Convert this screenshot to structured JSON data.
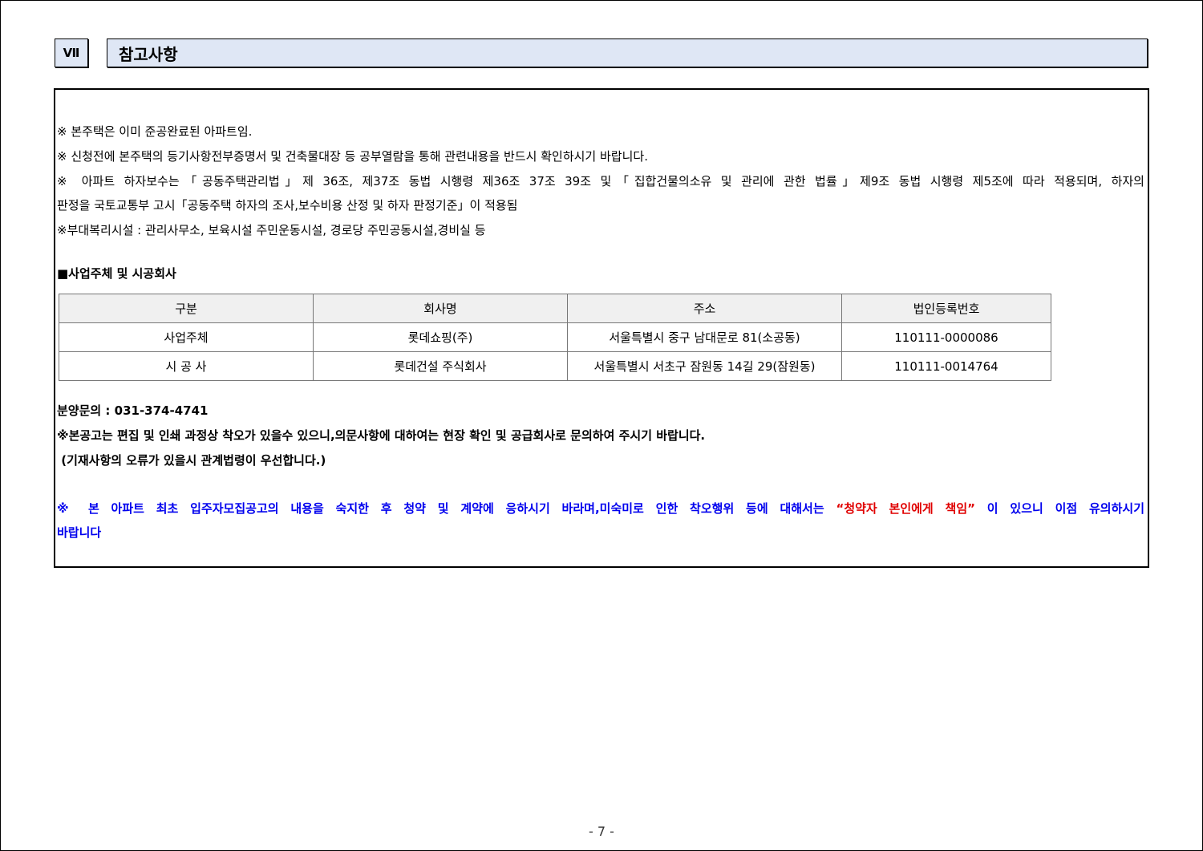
{
  "section": {
    "number": "Ⅶ",
    "title": "참고사항"
  },
  "notes": {
    "line1": "※ 본주택은 이미 준공완료된 아파트임.",
    "line2": "※ 신청전에 본주택의 등기사항전부증명서 및 건축물대장 등 공부열람을 통해 관련내용을 반드시 확인하시기 바랍니다.",
    "line3": "※ 아파트 하자보수는「공동주택관리법」제 36조, 제37조 동법 시행령 제36조 37조 39조 및「집합건물의소유 및 관리에 관한 법률」제9조  동법 시행령 제5조에 따라 적용되며, 하자의",
    "line4": "판정을 국토교통부 고시「공동주택 하자의 조사,보수비용 산정 및 하자 판정기준」이 적용됨",
    "line5": "※부대복리시설 : 관리사무소, 보육시설 주민운동시설, 경로당 주민공동시설,경비실 등"
  },
  "companies": {
    "heading": "■사업주체 및 시공회사",
    "headers": [
      "구분",
      "회사명",
      "주소",
      "법인등록번호"
    ],
    "rows": [
      [
        "사업주체",
        "롯데쇼핑(주)",
        "서울특별시 중구 남대문로 81(소공동)",
        "110111-0000086"
      ],
      [
        "시 공 사",
        "롯데건설 주식회사",
        "서울특별시 서초구 잠원동 14길 29(잠원동)",
        "110111-0014764"
      ]
    ]
  },
  "contact": {
    "phone_line": "분양문의 : 031-374-4741",
    "disclaimer1": "※본공고는 편집 및 인쇄 과정상 착오가 있을수 있으니,의문사항에 대하여는 현장 확인 및 공급회사로 문의하여 주시기 바랍니다.",
    "disclaimer2": " (기재사항의 오류가 있을시 관계법령이 우선합니다.)"
  },
  "notice": {
    "part1": "※ 본 아파트 최초 입주자모집공고의 내용을 숙지한 후 청약 및 계약에 응하시기 바라며,미숙미로 인한 착오행위 등에 대해서는",
    "highlight": "“청약자 본인에게 책임”",
    "part2": "이 있으니 이점 유의하시기",
    "part3": "바랍니다",
    "highlight_color": "#e00000",
    "text_color": "#0000ee"
  },
  "page_number": "- 7 -"
}
